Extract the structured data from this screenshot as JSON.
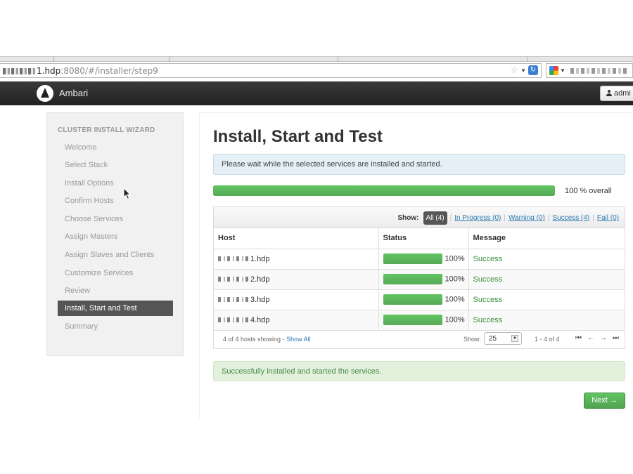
{
  "browser": {
    "url_host": "1.hdp",
    "url_path": ":8080/#/installer/step9"
  },
  "navbar": {
    "brand": "Ambari",
    "user_button": "admi"
  },
  "sidebar": {
    "header": "CLUSTER INSTALL WIZARD",
    "items": [
      {
        "label": "Welcome"
      },
      {
        "label": "Select Stack"
      },
      {
        "label": "Install Options"
      },
      {
        "label": "Confirm Hosts"
      },
      {
        "label": "Choose Services"
      },
      {
        "label": "Assign Masters"
      },
      {
        "label": "Assign Slaves and Clients"
      },
      {
        "label": "Customize Services"
      },
      {
        "label": "Review"
      },
      {
        "label": "Install, Start and Test",
        "active": true
      },
      {
        "label": "Summary"
      }
    ]
  },
  "main": {
    "title": "Install, Start and Test",
    "info_message": "Please wait while the selected services are installed and started.",
    "overall_progress_percent": 100,
    "overall_label": "100 % overall",
    "filters": {
      "show_label": "Show:",
      "all": "All (4)",
      "in_progress": "In Progress (0)",
      "warning": "Warning (0)",
      "success": "Success (4)",
      "fail": "Fail (0)"
    },
    "table": {
      "headers": [
        "Host",
        "Status",
        "Message"
      ],
      "rows": [
        {
          "host": "1.hdp",
          "progress": "100%",
          "message": "Success"
        },
        {
          "host": "2.hdp",
          "progress": "100%",
          "message": "Success"
        },
        {
          "host": "3.hdp",
          "progress": "100%",
          "message": "Success"
        },
        {
          "host": "4.hdp",
          "progress": "100%",
          "message": "Success"
        }
      ]
    },
    "footer": {
      "showing": "4 of 4 hosts showing - ",
      "show_all": "Show All",
      "show_label": "Show:",
      "per_page": "25",
      "range": "1 - 4 of 4"
    },
    "success_message": "Successfully installed and started the services.",
    "next_button": "Next →"
  }
}
